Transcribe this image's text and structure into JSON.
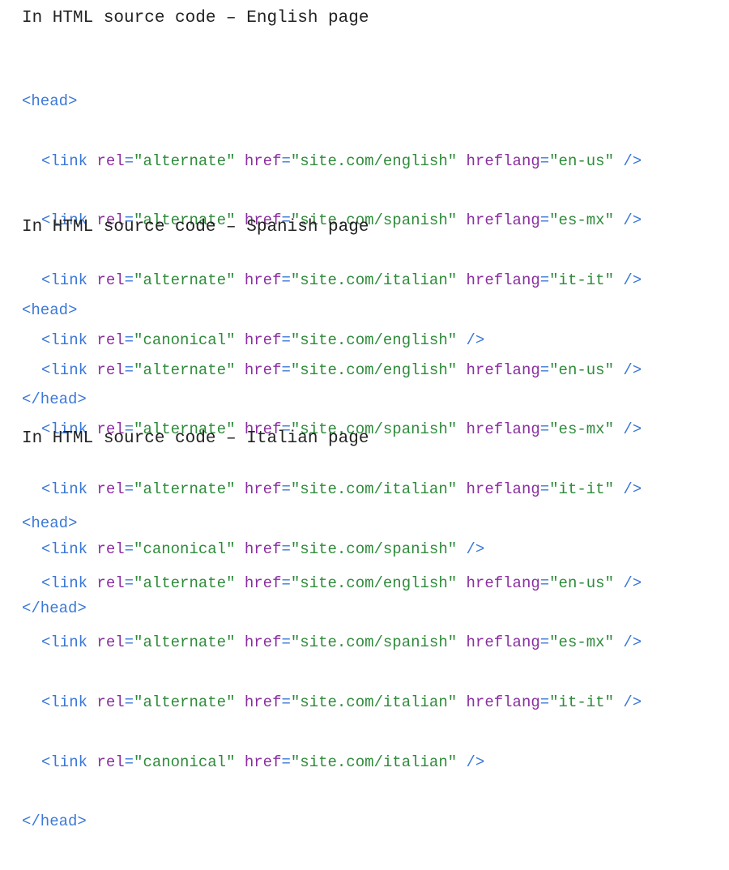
{
  "sections": [
    {
      "heading": "In HTML source code – English page",
      "open_tag": "<head>",
      "close_tag": "</head>",
      "links": [
        {
          "rel": "\"alternate\"",
          "href": "\"site.com/english\"",
          "hreflang": "\"en-us\""
        },
        {
          "rel": "\"alternate\"",
          "href": "\"site.com/spanish\"",
          "hreflang": "\"es-mx\""
        },
        {
          "rel": "\"alternate\"",
          "href": "\"site.com/italian\"",
          "hreflang": "\"it-it\""
        },
        {
          "rel": "\"canonical\"",
          "href": "\"site.com/english\""
        }
      ]
    },
    {
      "heading": "In HTML source code – Spanish page",
      "open_tag": "<head>",
      "close_tag": "</head>",
      "links": [
        {
          "rel": "\"alternate\"",
          "href": "\"site.com/english\"",
          "hreflang": "\"en-us\""
        },
        {
          "rel": "\"alternate\"",
          "href": "\"site.com/spanish\"",
          "hreflang": "\"es-mx\""
        },
        {
          "rel": "\"alternate\"",
          "href": "\"site.com/italian\"",
          "hreflang": "\"it-it\""
        },
        {
          "rel": "\"canonical\"",
          "href": "\"site.com/spanish\""
        }
      ]
    },
    {
      "heading": "In HTML source code – Italian page",
      "open_tag": "<head>",
      "close_tag": "</head>",
      "links": [
        {
          "rel": "\"alternate\"",
          "href": "\"site.com/english\"",
          "hreflang": "\"en-us\""
        },
        {
          "rel": "\"alternate\"",
          "href": "\"site.com/spanish\"",
          "hreflang": "\"es-mx\""
        },
        {
          "rel": "\"alternate\"",
          "href": "\"site.com/italian\"",
          "hreflang": "\"it-it\""
        },
        {
          "rel": "\"canonical\"",
          "href": "\"site.com/italian\""
        }
      ]
    }
  ],
  "syntax": {
    "link_open": "<link",
    "rel_attr": "rel",
    "href_attr": "href",
    "hreflang_attr": "hreflang",
    "equals": "=",
    "self_close": "/>"
  },
  "colors": {
    "tag": "#3b78d8",
    "attribute": "#8a2fa0",
    "value": "#2e8b3a",
    "heading_text": "#222222"
  }
}
